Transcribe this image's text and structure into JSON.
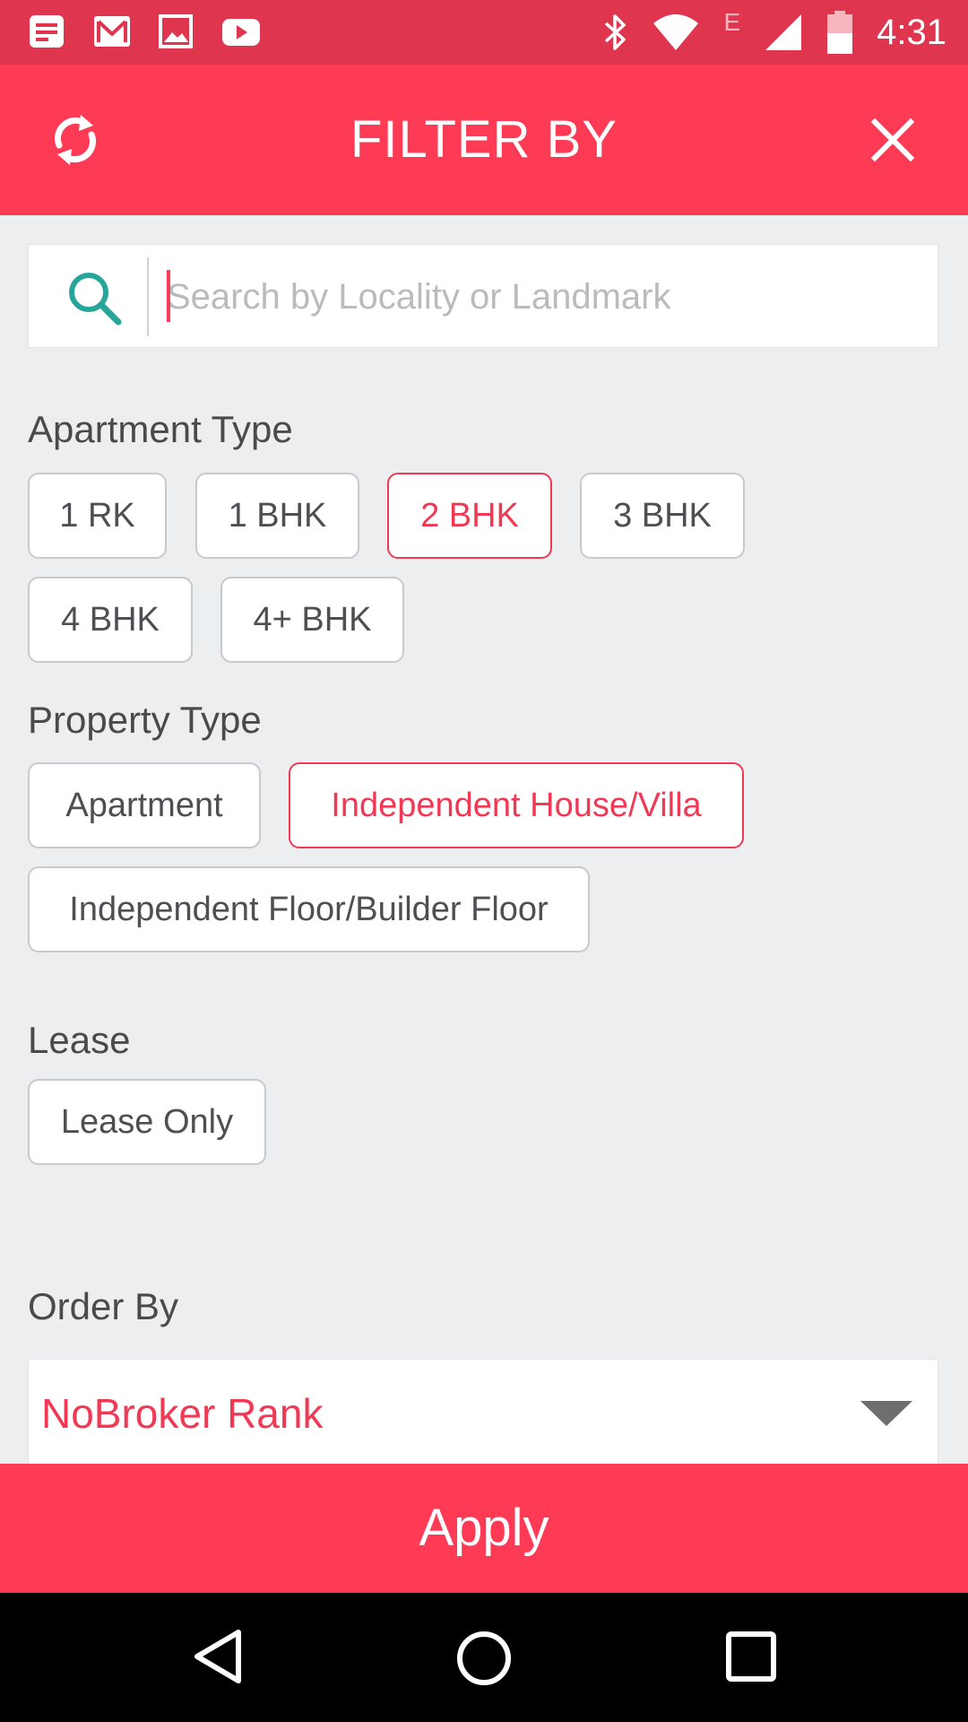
{
  "status_bar": {
    "time": "4:31",
    "network_label": "E",
    "left_icons": [
      "notes-icon",
      "gmail-icon",
      "gallery-icon",
      "youtube-icon"
    ],
    "right_icons": [
      "bluetooth-icon",
      "wifi-icon",
      "cellular-signal-icon",
      "battery-icon"
    ]
  },
  "header": {
    "title": "FILTER BY",
    "left_icon": "refresh-icon",
    "right_icon": "close-icon"
  },
  "search": {
    "placeholder": "Search by Locality or Landmark",
    "value": "",
    "icon": "search-icon"
  },
  "apartment_type": {
    "label": "Apartment Type",
    "options": [
      {
        "label": "1 RK",
        "selected": false
      },
      {
        "label": "1 BHK",
        "selected": false
      },
      {
        "label": "2 BHK",
        "selected": true
      },
      {
        "label": "3 BHK",
        "selected": false
      },
      {
        "label": "4 BHK",
        "selected": false
      },
      {
        "label": "4+ BHK",
        "selected": false
      }
    ]
  },
  "property_type": {
    "label": "Property Type",
    "options": [
      {
        "label": "Apartment",
        "selected": false
      },
      {
        "label": "Independent House/Villa",
        "selected": true
      },
      {
        "label": "Independent Floor/Builder Floor",
        "selected": false
      }
    ]
  },
  "lease": {
    "label": "Lease",
    "options": [
      {
        "label": "Lease Only",
        "selected": false
      }
    ]
  },
  "order_by": {
    "label": "Order By",
    "selected": "NoBroker Rank"
  },
  "apply_label": "Apply",
  "colors": {
    "brand": "#fe3a55",
    "status_bar": "#e0354f",
    "selected": "#f03a55",
    "search_icon": "#26a69a",
    "background": "#edeef0"
  }
}
